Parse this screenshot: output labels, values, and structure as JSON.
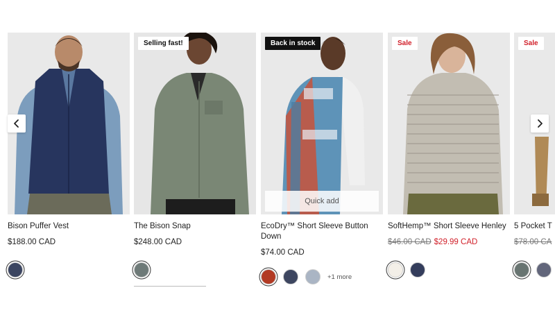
{
  "carousel": {
    "prev_icon": "chevron-left-icon",
    "next_icon": "chevron-right-icon",
    "products": [
      {
        "name": "Bison Puffer Vest",
        "price": "$188.00 CAD",
        "badge": "",
        "swatches": [
          {
            "color": "#3b4561"
          }
        ]
      },
      {
        "name": "The Bison Snap",
        "price": "$248.00 CAD",
        "badge": "Selling fast!",
        "swatches": [
          {
            "color": "#6e7a78"
          }
        ]
      },
      {
        "name": "EcoDry™ Short Sleeve Button Down",
        "price": "$74.00 CAD",
        "badge": "Back in stock",
        "quick_add": "Quick add",
        "swatches": [
          {
            "color": "#b23a24"
          },
          {
            "color": "#3d4660"
          },
          {
            "color": "#aab5c4"
          }
        ],
        "more": "+1 more"
      },
      {
        "name": "SoftHemp™ Short Sleeve Henley",
        "old_price": "$46.00 CAD",
        "sale_price": "$29.99 CAD",
        "badge": "Sale",
        "swatches": [
          {
            "color": "#f3efe8"
          },
          {
            "color": "#343d5c"
          }
        ]
      },
      {
        "name": "5 Pocket T",
        "old_price": "$78.00 CA",
        "badge": "Sale",
        "swatches": [
          {
            "color": "#687471"
          },
          {
            "color": "#62667b"
          }
        ]
      }
    ]
  },
  "colors": {
    "sale": "#d1202a",
    "card_bg": "#e8e8e8"
  }
}
